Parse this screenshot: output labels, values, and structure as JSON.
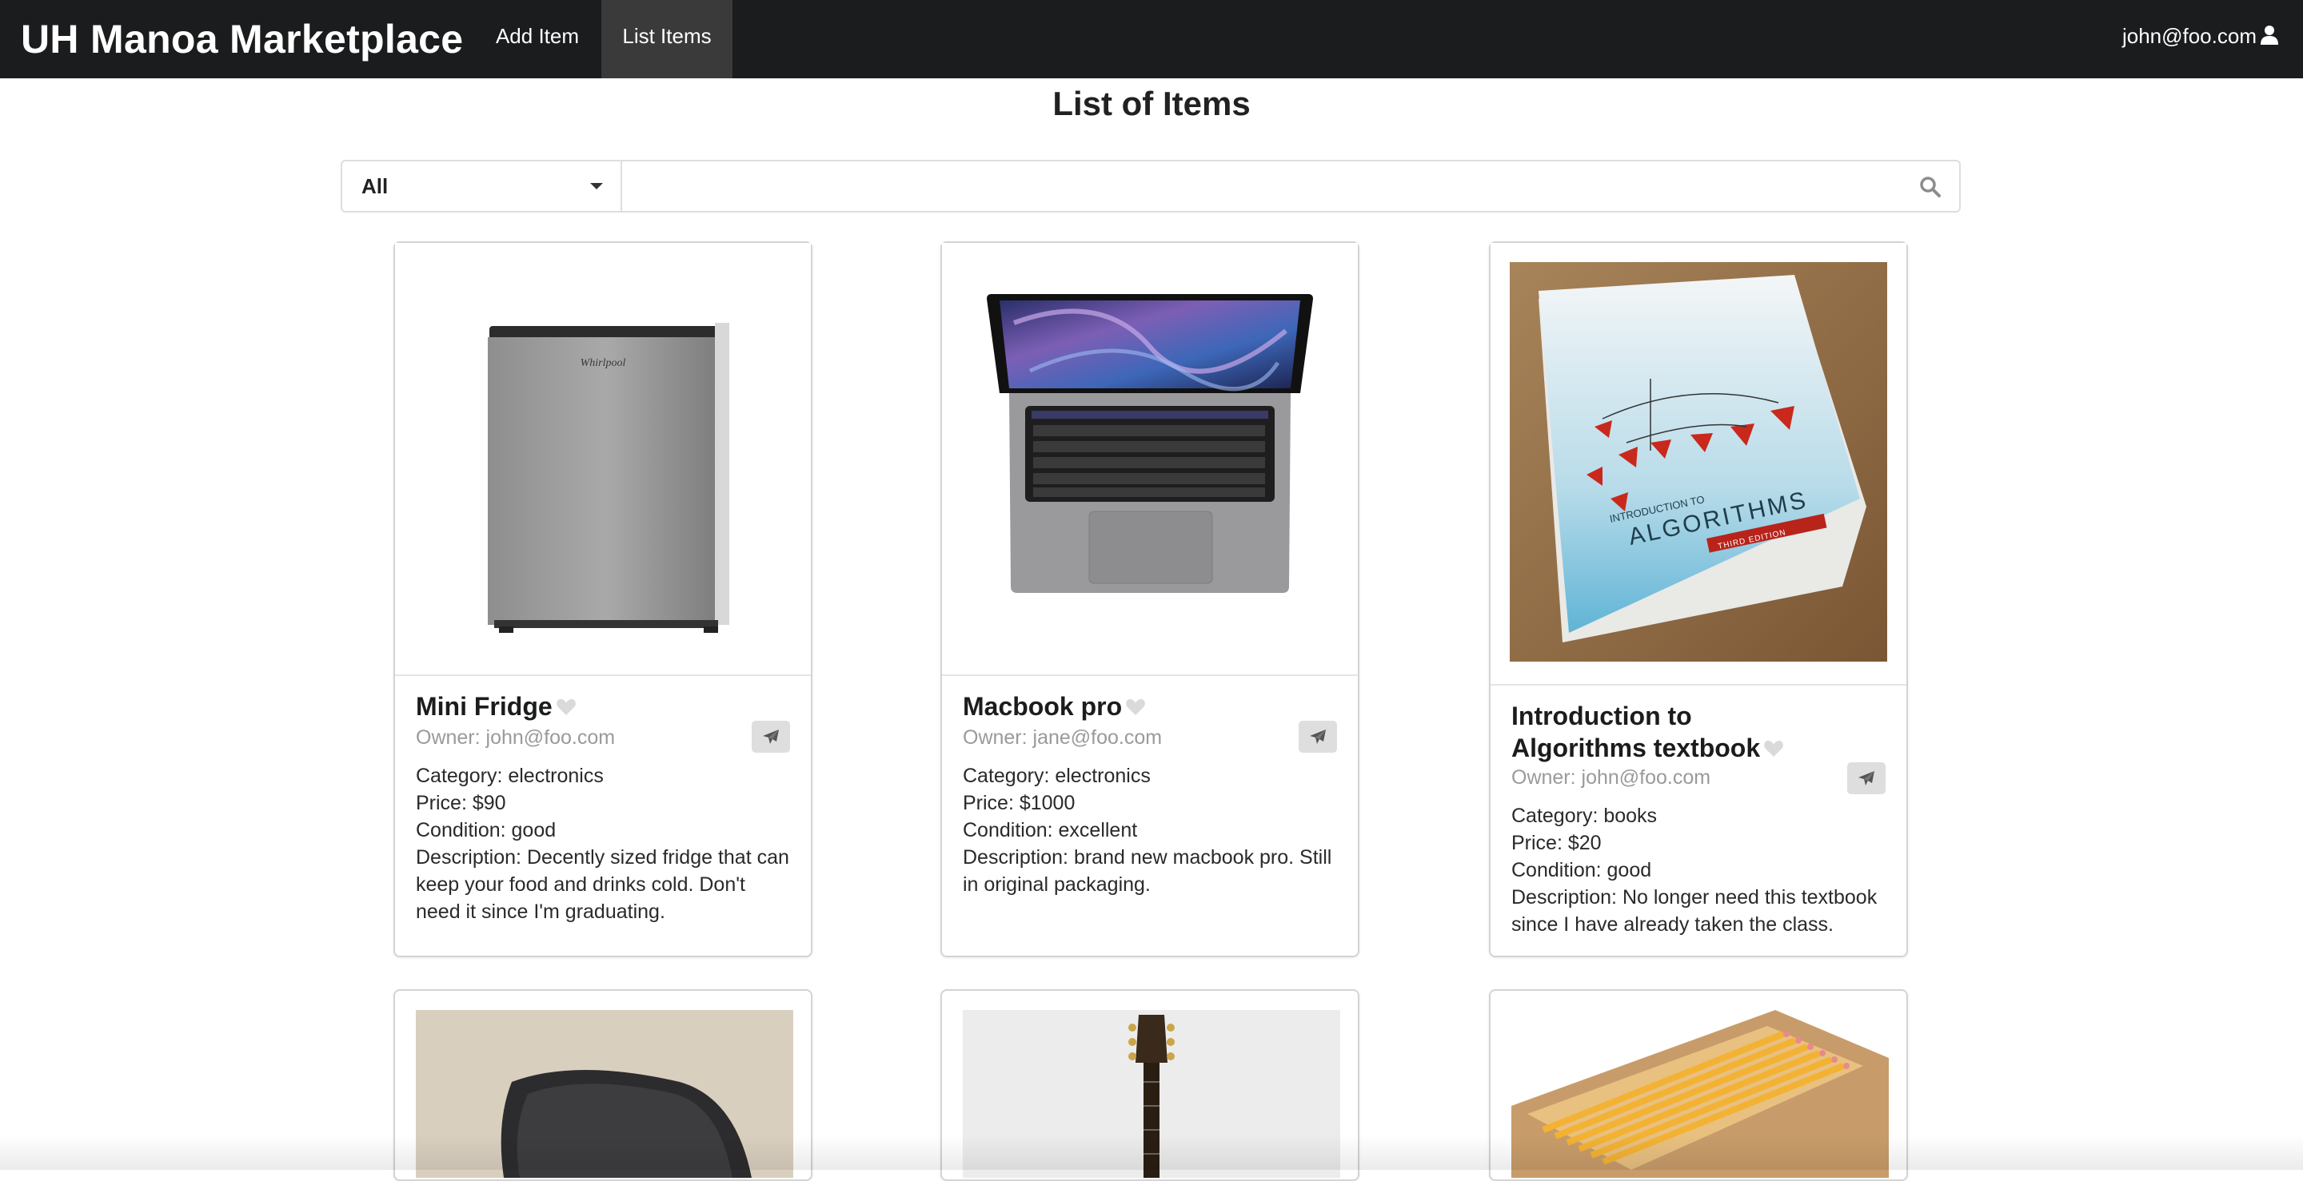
{
  "navbar": {
    "brand": "UH Manoa Marketplace",
    "add_item": "Add Item",
    "list_items": "List Items",
    "user_email": "john@foo.com"
  },
  "page": {
    "title": "List of Items"
  },
  "search": {
    "category_value": "All",
    "query": "",
    "placeholder": ""
  },
  "items": [
    {
      "name": "Mini Fridge",
      "owner": "Owner: john@foo.com",
      "category": "Category: electronics",
      "price": "Price: $90",
      "condition": "Condition: good",
      "description": "Description: Decently sized fridge that can keep your food and drinks cold. Don't need it since I'm graduating."
    },
    {
      "name": "Macbook pro",
      "owner": "Owner: jane@foo.com",
      "category": "Category: electronics",
      "price": "Price: $1000",
      "condition": "Condition: excellent",
      "description": "Description: brand new macbook pro. Still in original packaging."
    },
    {
      "name": "Introduction to Algorithms textbook",
      "owner": "Owner: john@foo.com",
      "category": "Category: books",
      "price": "Price: $20",
      "condition": "Condition: good",
      "description": "Description: No longer need this textbook since I have already taken the class.",
      "image_text": {
        "title_small": "INTRODUCTION TO",
        "title_big": "ALGORITHMS",
        "edition": "THIRD EDITION"
      }
    }
  ],
  "colors": {
    "navbar_bg": "#1b1c1d",
    "active_tab_bg": "#3a3a3b",
    "card_border": "#d4d4d5"
  },
  "icons": {
    "user": "user-icon",
    "search": "search-icon",
    "heart": "heart-icon",
    "share": "paper-plane-icon"
  }
}
